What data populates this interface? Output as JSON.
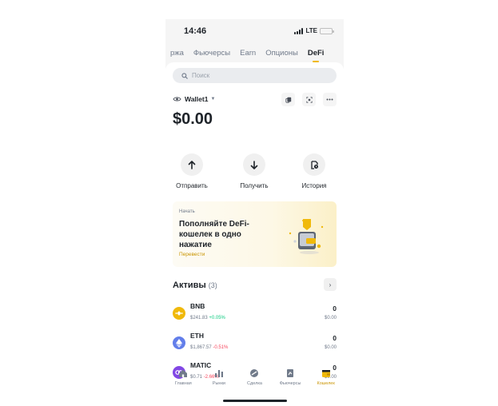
{
  "status_bar": {
    "time": "14:46",
    "network": "LTE"
  },
  "top_tabs": [
    {
      "label": "ржа"
    },
    {
      "label": "Фьючерсы"
    },
    {
      "label": "Earn"
    },
    {
      "label": "Опционы"
    },
    {
      "label": "DeFi",
      "active": true
    }
  ],
  "search": {
    "placeholder": "Поиск"
  },
  "wallet": {
    "name": "Wallet1",
    "balance": "$0.00",
    "header_icons": [
      "copy-icon",
      "scan-icon",
      "more-icon"
    ]
  },
  "actions": [
    {
      "label": "Отправить",
      "icon": "arrow-up-icon"
    },
    {
      "label": "Получить",
      "icon": "arrow-down-icon"
    },
    {
      "label": "История",
      "icon": "history-icon"
    }
  ],
  "promo": {
    "eyebrow": "Начать",
    "title": "Пополняйте DeFi-кошелек в одно нажатие",
    "link": "Перевести"
  },
  "assets": {
    "title": "Активы",
    "count": "(3)",
    "items": [
      {
        "symbol": "BNB",
        "price": "$241.83",
        "change": "+0.05%",
        "direction": "up",
        "amount": "0",
        "value": "$0.00",
        "color": "#f0b90b"
      },
      {
        "symbol": "ETH",
        "price": "$1,867.57",
        "change": "-0.51%",
        "direction": "down",
        "amount": "0",
        "value": "$0.00",
        "color": "#627eea"
      },
      {
        "symbol": "MATIC",
        "price": "$0.71",
        "change": "-2.66%",
        "direction": "down",
        "amount": "0",
        "value": "$0.00",
        "color": "#8247e5"
      }
    ]
  },
  "bottom_nav": [
    {
      "label": "Главная",
      "icon": "home-icon"
    },
    {
      "label": "Рынки",
      "icon": "markets-icon"
    },
    {
      "label": "Сделка",
      "icon": "trade-icon"
    },
    {
      "label": "Фьючерсы",
      "icon": "futures-icon"
    },
    {
      "label": "Кошелек",
      "icon": "wallet-icon",
      "active": true
    }
  ],
  "colors": {
    "accent": "#f0b90b",
    "up": "#0ecb81",
    "down": "#f6465d",
    "text": "#1e2329",
    "muted": "#707a8a"
  }
}
